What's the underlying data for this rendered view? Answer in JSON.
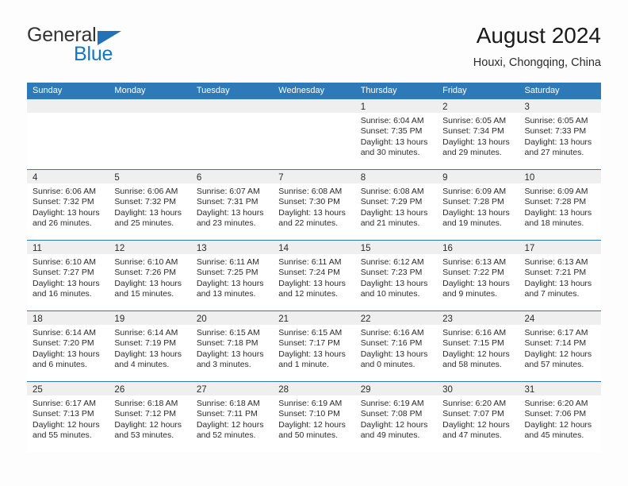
{
  "logo": {
    "word1": "General",
    "word2": "Blue",
    "flag_color": "#2472b6",
    "word2_color": "#1277c4"
  },
  "header": {
    "title": "August 2024",
    "location": "Houxi, Chongqing, China"
  },
  "theme": {
    "header_blue": "#2e7ab8",
    "day_band_gray": "#efefef",
    "text": "#2b2b2b"
  },
  "weekdays": [
    "Sunday",
    "Monday",
    "Tuesday",
    "Wednesday",
    "Thursday",
    "Friday",
    "Saturday"
  ],
  "weeks": [
    [
      {
        "day": "",
        "empty": true,
        "lines": []
      },
      {
        "day": "",
        "empty": true,
        "lines": []
      },
      {
        "day": "",
        "empty": true,
        "lines": []
      },
      {
        "day": "",
        "empty": true,
        "lines": []
      },
      {
        "day": "1",
        "lines": [
          "Sunrise: 6:04 AM",
          "Sunset: 7:35 PM",
          "Daylight: 13 hours",
          "and 30 minutes."
        ]
      },
      {
        "day": "2",
        "lines": [
          "Sunrise: 6:05 AM",
          "Sunset: 7:34 PM",
          "Daylight: 13 hours",
          "and 29 minutes."
        ]
      },
      {
        "day": "3",
        "lines": [
          "Sunrise: 6:05 AM",
          "Sunset: 7:33 PM",
          "Daylight: 13 hours",
          "and 27 minutes."
        ]
      }
    ],
    [
      {
        "day": "4",
        "lines": [
          "Sunrise: 6:06 AM",
          "Sunset: 7:32 PM",
          "Daylight: 13 hours",
          "and 26 minutes."
        ]
      },
      {
        "day": "5",
        "lines": [
          "Sunrise: 6:06 AM",
          "Sunset: 7:32 PM",
          "Daylight: 13 hours",
          "and 25 minutes."
        ]
      },
      {
        "day": "6",
        "lines": [
          "Sunrise: 6:07 AM",
          "Sunset: 7:31 PM",
          "Daylight: 13 hours",
          "and 23 minutes."
        ]
      },
      {
        "day": "7",
        "lines": [
          "Sunrise: 6:08 AM",
          "Sunset: 7:30 PM",
          "Daylight: 13 hours",
          "and 22 minutes."
        ]
      },
      {
        "day": "8",
        "lines": [
          "Sunrise: 6:08 AM",
          "Sunset: 7:29 PM",
          "Daylight: 13 hours",
          "and 21 minutes."
        ]
      },
      {
        "day": "9",
        "lines": [
          "Sunrise: 6:09 AM",
          "Sunset: 7:28 PM",
          "Daylight: 13 hours",
          "and 19 minutes."
        ]
      },
      {
        "day": "10",
        "lines": [
          "Sunrise: 6:09 AM",
          "Sunset: 7:28 PM",
          "Daylight: 13 hours",
          "and 18 minutes."
        ]
      }
    ],
    [
      {
        "day": "11",
        "lines": [
          "Sunrise: 6:10 AM",
          "Sunset: 7:27 PM",
          "Daylight: 13 hours",
          "and 16 minutes."
        ]
      },
      {
        "day": "12",
        "lines": [
          "Sunrise: 6:10 AM",
          "Sunset: 7:26 PM",
          "Daylight: 13 hours",
          "and 15 minutes."
        ]
      },
      {
        "day": "13",
        "lines": [
          "Sunrise: 6:11 AM",
          "Sunset: 7:25 PM",
          "Daylight: 13 hours",
          "and 13 minutes."
        ]
      },
      {
        "day": "14",
        "lines": [
          "Sunrise: 6:11 AM",
          "Sunset: 7:24 PM",
          "Daylight: 13 hours",
          "and 12 minutes."
        ]
      },
      {
        "day": "15",
        "lines": [
          "Sunrise: 6:12 AM",
          "Sunset: 7:23 PM",
          "Daylight: 13 hours",
          "and 10 minutes."
        ]
      },
      {
        "day": "16",
        "lines": [
          "Sunrise: 6:13 AM",
          "Sunset: 7:22 PM",
          "Daylight: 13 hours",
          "and 9 minutes."
        ]
      },
      {
        "day": "17",
        "lines": [
          "Sunrise: 6:13 AM",
          "Sunset: 7:21 PM",
          "Daylight: 13 hours",
          "and 7 minutes."
        ]
      }
    ],
    [
      {
        "day": "18",
        "lines": [
          "Sunrise: 6:14 AM",
          "Sunset: 7:20 PM",
          "Daylight: 13 hours",
          "and 6 minutes."
        ]
      },
      {
        "day": "19",
        "lines": [
          "Sunrise: 6:14 AM",
          "Sunset: 7:19 PM",
          "Daylight: 13 hours",
          "and 4 minutes."
        ]
      },
      {
        "day": "20",
        "lines": [
          "Sunrise: 6:15 AM",
          "Sunset: 7:18 PM",
          "Daylight: 13 hours",
          "and 3 minutes."
        ]
      },
      {
        "day": "21",
        "lines": [
          "Sunrise: 6:15 AM",
          "Sunset: 7:17 PM",
          "Daylight: 13 hours",
          "and 1 minute."
        ]
      },
      {
        "day": "22",
        "lines": [
          "Sunrise: 6:16 AM",
          "Sunset: 7:16 PM",
          "Daylight: 13 hours",
          "and 0 minutes."
        ]
      },
      {
        "day": "23",
        "lines": [
          "Sunrise: 6:16 AM",
          "Sunset: 7:15 PM",
          "Daylight: 12 hours",
          "and 58 minutes."
        ]
      },
      {
        "day": "24",
        "lines": [
          "Sunrise: 6:17 AM",
          "Sunset: 7:14 PM",
          "Daylight: 12 hours",
          "and 57 minutes."
        ]
      }
    ],
    [
      {
        "day": "25",
        "lines": [
          "Sunrise: 6:17 AM",
          "Sunset: 7:13 PM",
          "Daylight: 12 hours",
          "and 55 minutes."
        ]
      },
      {
        "day": "26",
        "lines": [
          "Sunrise: 6:18 AM",
          "Sunset: 7:12 PM",
          "Daylight: 12 hours",
          "and 53 minutes."
        ]
      },
      {
        "day": "27",
        "lines": [
          "Sunrise: 6:18 AM",
          "Sunset: 7:11 PM",
          "Daylight: 12 hours",
          "and 52 minutes."
        ]
      },
      {
        "day": "28",
        "lines": [
          "Sunrise: 6:19 AM",
          "Sunset: 7:10 PM",
          "Daylight: 12 hours",
          "and 50 minutes."
        ]
      },
      {
        "day": "29",
        "lines": [
          "Sunrise: 6:19 AM",
          "Sunset: 7:08 PM",
          "Daylight: 12 hours",
          "and 49 minutes."
        ]
      },
      {
        "day": "30",
        "lines": [
          "Sunrise: 6:20 AM",
          "Sunset: 7:07 PM",
          "Daylight: 12 hours",
          "and 47 minutes."
        ]
      },
      {
        "day": "31",
        "lines": [
          "Sunrise: 6:20 AM",
          "Sunset: 7:06 PM",
          "Daylight: 12 hours",
          "and 45 minutes."
        ]
      }
    ]
  ]
}
